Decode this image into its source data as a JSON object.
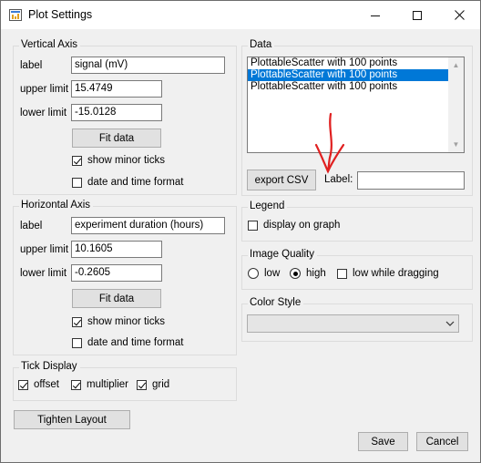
{
  "window": {
    "title": "Plot Settings",
    "minimize": "—",
    "maximize": "☐",
    "close": "✕"
  },
  "vertical_axis": {
    "title": "Vertical Axis",
    "label_caption": "label",
    "label_value": "signal (mV)",
    "upper_caption": "upper limit",
    "upper_value": "15.4749",
    "lower_caption": "lower limit",
    "lower_value": "-15.0128",
    "fit_button": "Fit data",
    "minor_ticks": "show minor ticks",
    "minor_ticks_checked": true,
    "datetime": "date and time format",
    "datetime_checked": false
  },
  "horizontal_axis": {
    "title": "Horizontal Axis",
    "label_caption": "label",
    "label_value": "experiment duration (hours)",
    "upper_caption": "upper limit",
    "upper_value": "10.1605",
    "lower_caption": "lower limit",
    "lower_value": "-0.2605",
    "fit_button": "Fit data",
    "minor_ticks": "show minor ticks",
    "minor_ticks_checked": true,
    "datetime": "date and time format",
    "datetime_checked": false
  },
  "tick_display": {
    "title": "Tick Display",
    "offset": "offset",
    "multiplier": "multiplier",
    "grid": "grid"
  },
  "tighten_button": "Tighten Layout",
  "data": {
    "title": "Data",
    "items": [
      "PlottableScatter with 100 points",
      "PlottableScatter with 100 points",
      "PlottableScatter with 100 points"
    ],
    "selected_index": 1,
    "export_button": "export CSV",
    "label_caption": "Label:",
    "label_value": ""
  },
  "legend": {
    "title": "Legend",
    "display": "display on graph",
    "display_checked": false
  },
  "image_quality": {
    "title": "Image Quality",
    "low": "low",
    "high": "high",
    "selected": "high",
    "low_while_dragging": "low while dragging",
    "low_while_dragging_checked": false
  },
  "color_style": {
    "title": "Color Style",
    "selected": ""
  },
  "save_button": "Save",
  "cancel_button": "Cancel",
  "annotation_color": "#e02020"
}
